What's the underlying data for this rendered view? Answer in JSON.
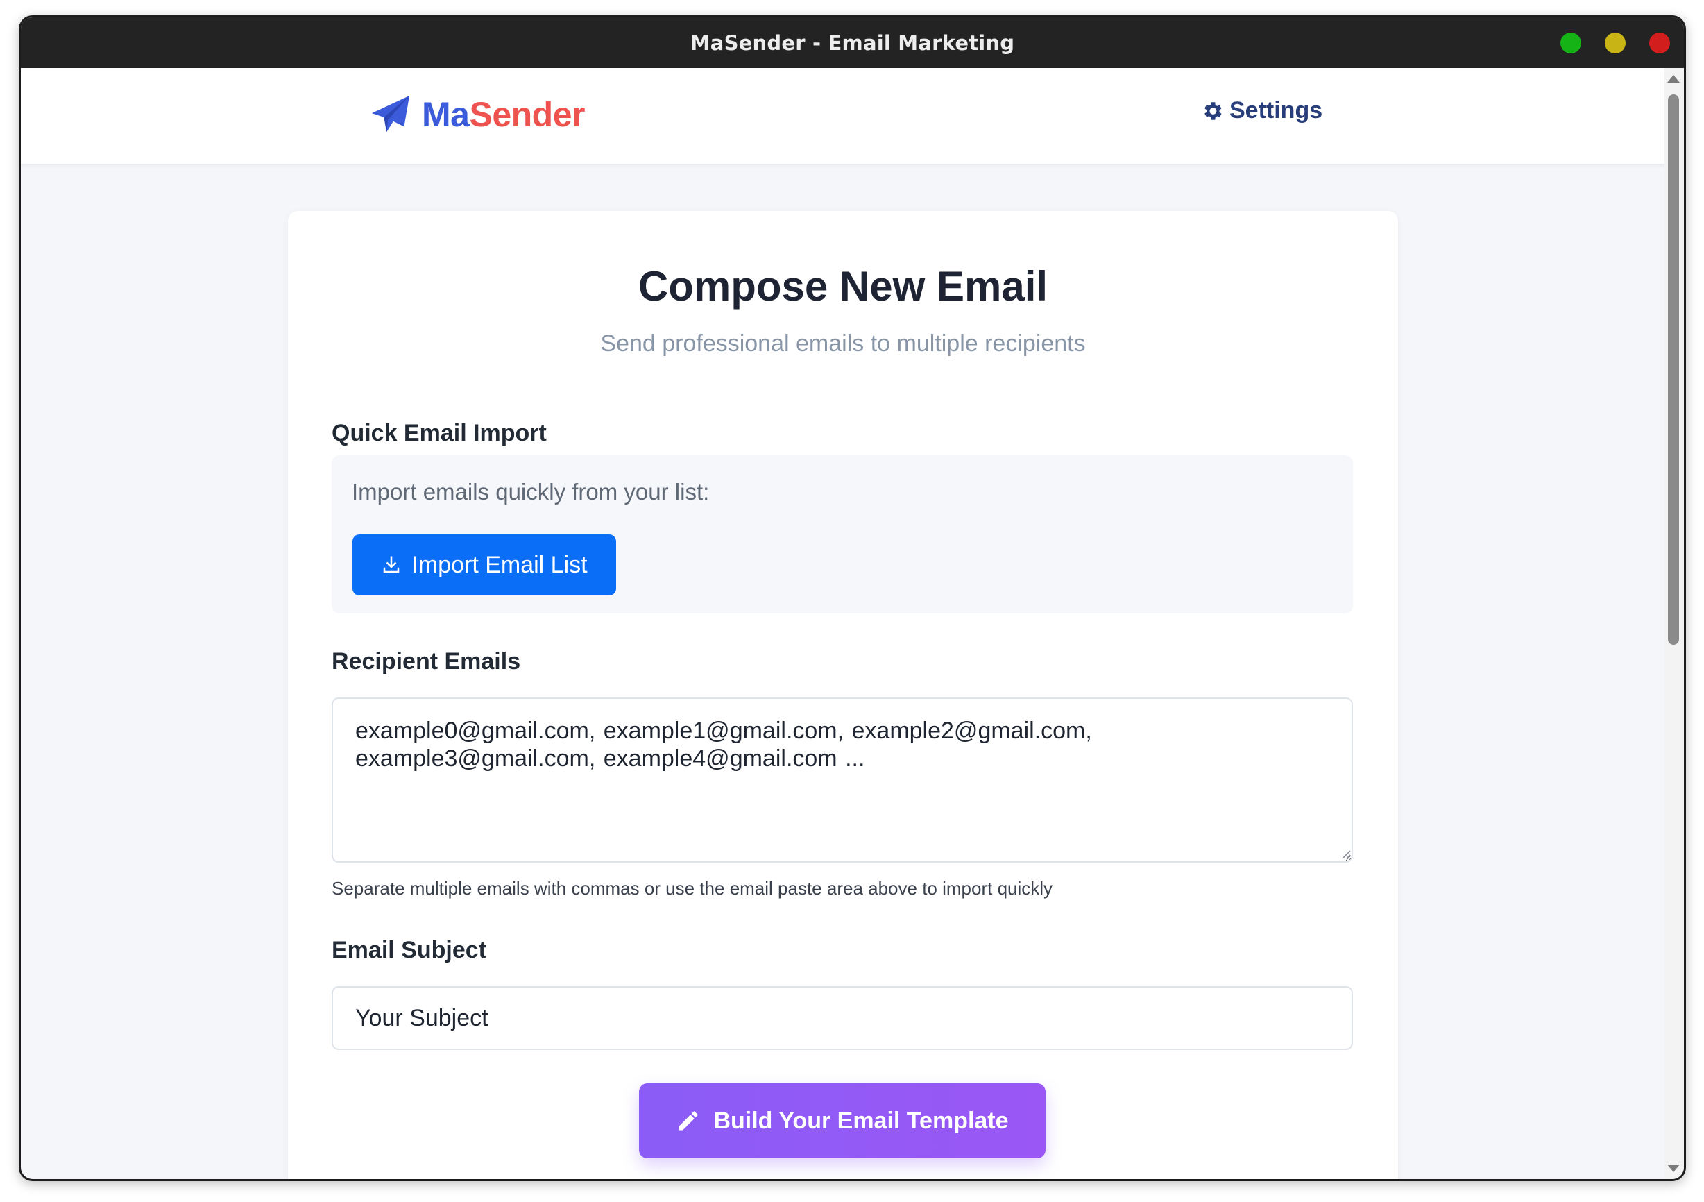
{
  "window": {
    "title": "MaSender - Email Marketing"
  },
  "header": {
    "logo_part1": "Ma",
    "logo_part2": "Sender",
    "logo_icon": "paper-plane-icon",
    "settings_label": "Settings",
    "settings_icon": "gear-icon"
  },
  "composer": {
    "title": "Compose New Email",
    "subtitle": "Send professional emails to multiple recipients",
    "quick_import": {
      "label": "Quick Email Import",
      "description": "Import emails quickly from your list:",
      "button_label": "Import Email List",
      "button_icon": "download-icon"
    },
    "recipients": {
      "label": "Recipient Emails",
      "value": "example0@gmail.com, example1@gmail.com, example2@gmail.com, example3@gmail.com, example4@gmail.com ...",
      "hint": "Separate multiple emails with commas or use the email paste area above to import quickly"
    },
    "subject": {
      "label": "Email Subject",
      "placeholder": "Your Subject"
    },
    "template_button": {
      "label": "Build Your Email Template",
      "icon": "pencil-icon"
    }
  },
  "colors": {
    "brand_blue": "#3b5bdb",
    "brand_red": "#ef5350",
    "primary_button": "#0b6ef7",
    "template_button": "#8b5cf6"
  }
}
